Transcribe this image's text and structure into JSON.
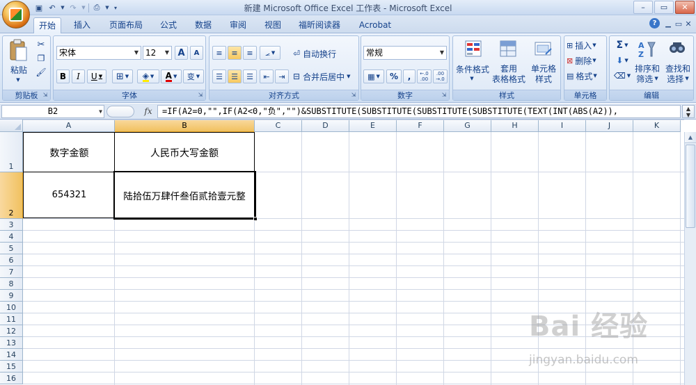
{
  "window": {
    "title": "新建 Microsoft Office Excel 工作表 - Microsoft Excel"
  },
  "tabs": [
    {
      "label": "开始",
      "active": true
    },
    {
      "label": "插入"
    },
    {
      "label": "页面布局"
    },
    {
      "label": "公式"
    },
    {
      "label": "数据"
    },
    {
      "label": "审阅"
    },
    {
      "label": "视图"
    },
    {
      "label": "福昕阅读器"
    },
    {
      "label": "Acrobat"
    }
  ],
  "ribbon": {
    "clipboard": {
      "group_label": "剪贴板",
      "paste_label": "粘贴"
    },
    "font": {
      "group_label": "字体",
      "font_name": "宋体",
      "font_size": "12",
      "bold": "B",
      "italic": "I",
      "underline": "U",
      "grow": "A",
      "shrink": "A",
      "font_color_label": "A",
      "phonetic": "变"
    },
    "alignment": {
      "group_label": "对齐方式",
      "wrap_text": "自动换行",
      "merge_center": "合并后居中"
    },
    "number": {
      "group_label": "数字",
      "format": "常规",
      "percent": "%",
      "comma": ",",
      "increase_decimal": "←.0 .00",
      "decrease_decimal": ".00 →.0"
    },
    "styles": {
      "group_label": "样式",
      "conditional": "条件格式",
      "table_format_1": "套用",
      "table_format_2": "表格格式",
      "cell_style_1": "单元格",
      "cell_style_2": "样式"
    },
    "cells": {
      "group_label": "单元格",
      "insert": "插入",
      "delete": "删除",
      "format": "格式"
    },
    "editing": {
      "group_label": "编辑",
      "sort_1": "排序和",
      "sort_2": "筛选",
      "find_1": "查找和",
      "find_2": "选择",
      "sum": "Σ"
    }
  },
  "formula_bar": {
    "name_box": "B2",
    "fx": "fx",
    "formula": "=IF(A2=0,\"\",IF(A2<0,\"负\",\"\")&SUBSTITUTE(SUBSTITUTE(SUBSTITUTE(SUBSTITUTE(TEXT(INT(ABS(A2)),"
  },
  "sheet": {
    "columns": [
      "A",
      "B",
      "C",
      "D",
      "E",
      "F",
      "G",
      "H",
      "I",
      "J",
      "K"
    ],
    "selected_column": "B",
    "rows": [
      "1",
      "2",
      "3",
      "4",
      "5",
      "6",
      "7",
      "8",
      "9",
      "10",
      "11",
      "12",
      "13",
      "14",
      "15",
      "16"
    ],
    "selected_row": "2",
    "cells": {
      "A1": "数字金额",
      "B1": "人民币大写金额",
      "A2": "654321",
      "B2": "陆拾伍万肆仟叁佰贰拾壹元整"
    }
  },
  "watermark": {
    "logo": "Bai 经验",
    "url": "jingyan.baidu.com"
  }
}
